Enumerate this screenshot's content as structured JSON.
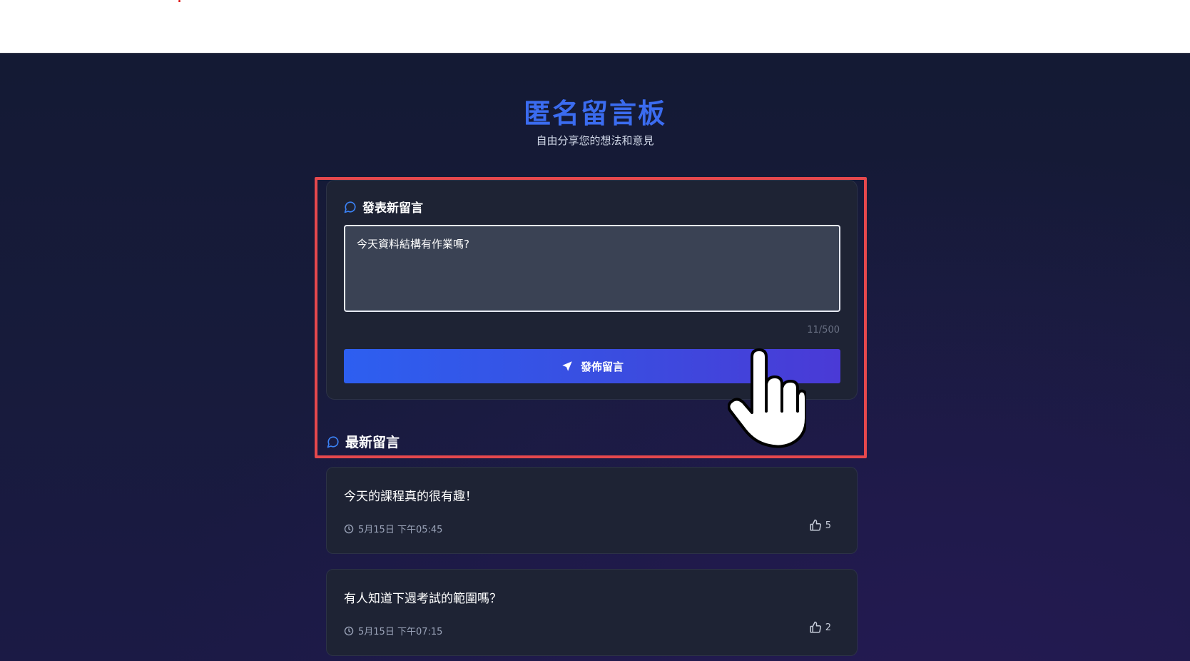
{
  "header": {
    "title": "匿名留言板",
    "subtitle": "自由分享您的想法和意見"
  },
  "composer": {
    "title": "發表新留言",
    "input_value": "今天資料結構有作業嗎?",
    "char_count": "11/500",
    "post_label": "發佈留言"
  },
  "latest": {
    "title": "最新留言"
  },
  "posts": [
    {
      "text": "今天的課程真的很有趣！",
      "time": "5月15日 下午05:45",
      "likes": "5"
    },
    {
      "text": "有人知道下週考試的範圍嗎？",
      "time": "5月15日 下午07:15",
      "likes": "2"
    }
  ],
  "colors": {
    "accent": "#3b6cf0",
    "highlight": "#e5484d",
    "card_bg": "#1e2334"
  },
  "icons": [
    "message-bubble-icon",
    "send-icon",
    "clock-icon",
    "thumbs-up-icon",
    "hand-pointer-cursor"
  ]
}
